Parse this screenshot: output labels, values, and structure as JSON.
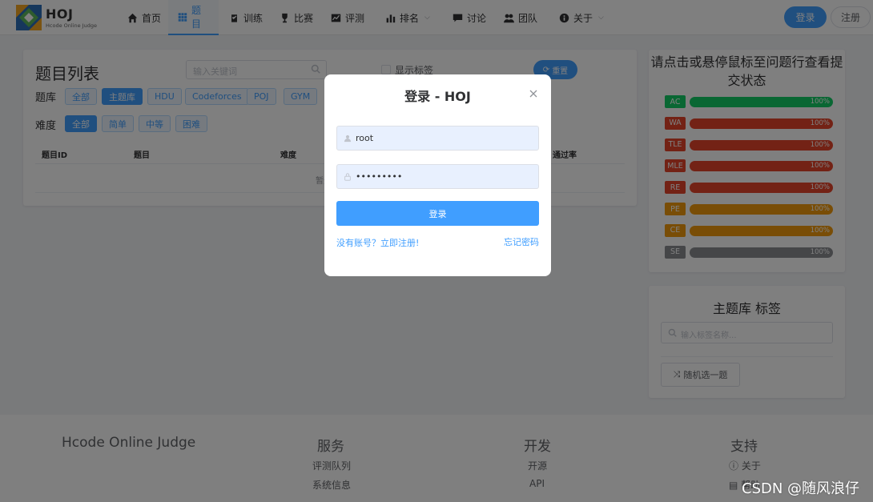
{
  "brand": {
    "name": "HOJ",
    "subtitle": "Hcode Online Judge"
  },
  "nav": {
    "items": [
      {
        "label": "首页",
        "icon": "home-icon"
      },
      {
        "label": "题目",
        "icon": "grid-icon",
        "active": true
      },
      {
        "label": "训练",
        "icon": "clipboard-icon"
      },
      {
        "label": "比赛",
        "icon": "trophy-icon"
      },
      {
        "label": "评测",
        "icon": "chart-icon"
      },
      {
        "label": "排名",
        "icon": "bar-chart-icon"
      },
      {
        "label": "讨论",
        "icon": "chat-icon"
      },
      {
        "label": "团队",
        "icon": "users-icon"
      },
      {
        "label": "关于",
        "icon": "info-icon"
      }
    ],
    "login": "登录",
    "register": "注册"
  },
  "problems": {
    "title": "题目列表",
    "search_placeholder": "输入关键词",
    "show_tags": "显示标签",
    "reset": "重置",
    "bank_label": "题库",
    "banks": [
      "全部",
      "主题库",
      "HDU",
      "Codeforces",
      "POJ",
      "GYM"
    ],
    "difficulty_label": "难度",
    "difficulties": [
      "全部",
      "简单",
      "中等",
      "困难"
    ],
    "columns": {
      "id": "题目ID",
      "title": "题目",
      "difficulty": "难度",
      "rate": "通过率"
    },
    "empty_text": "暂无"
  },
  "status_panel": {
    "title": "请点击或悬停鼠标至问题行查看提交状态",
    "rows": [
      {
        "label": "AC",
        "percent": "100%",
        "color": "#13ce66"
      },
      {
        "label": "WA",
        "percent": "100%",
        "color": "#e6452a"
      },
      {
        "label": "TLE",
        "percent": "100%",
        "color": "#e6452a"
      },
      {
        "label": "MLE",
        "percent": "100%",
        "color": "#e6452a"
      },
      {
        "label": "RE",
        "percent": "100%",
        "color": "#e6452a"
      },
      {
        "label": "PE",
        "percent": "100%",
        "color": "#f29a0c"
      },
      {
        "label": "CE",
        "percent": "100%",
        "color": "#f29a0c"
      },
      {
        "label": "SE",
        "percent": "100%",
        "color": "#8a8d91"
      }
    ]
  },
  "tag_panel": {
    "title": "主题库 标签",
    "search_placeholder": "输入标签名称...",
    "random_button": "随机选一题"
  },
  "footer": {
    "brand": "Hcode Online Judge",
    "services": {
      "heading": "服务",
      "links": [
        "评测队列",
        "系统信息"
      ]
    },
    "dev": {
      "heading": "开发",
      "links": [
        "开源",
        "API"
      ]
    },
    "support": {
      "heading": "支持",
      "links": [
        "关于",
        "帮助"
      ]
    },
    "watermark": "CSDN @随风浪仔"
  },
  "login_modal": {
    "title": "登录 - HOJ",
    "username_value": "root",
    "password_value": "•••••••••",
    "submit": "登录",
    "register_link": "没有账号？立即注册!",
    "forgot_link": "忘记密码"
  }
}
